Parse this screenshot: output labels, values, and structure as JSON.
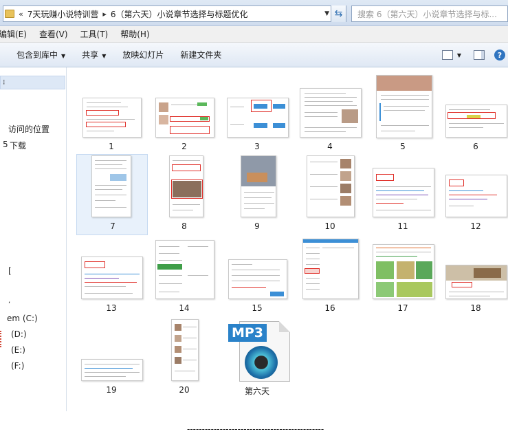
{
  "address_bar": {
    "lead_symbol": "«",
    "crumbs": [
      "7天玩赚小说特训营",
      "6（第六天）小说章节选择与标题优化"
    ],
    "search_placeholder": "搜索 6（第六天）小说章节选择与标..."
  },
  "menu": [
    "编辑(E)",
    "查看(V)",
    "工具(T)",
    "帮助(H)"
  ],
  "toolbar": {
    "include_library": "包含到库中",
    "share": "共享",
    "slideshow": "放映幻灯片",
    "new_folder": "新建文件夹"
  },
  "nav": {
    "recent_places": "访问的位置",
    "downloads": "下载",
    "bracket": "[",
    "drive_c": "em (C:)",
    "drive_d": "(D:)",
    "drive_e": "(E:)",
    "drive_f": "(F:)",
    "downloads_prefix": "5"
  },
  "files": [
    {
      "label": "1"
    },
    {
      "label": "2"
    },
    {
      "label": "3"
    },
    {
      "label": "4"
    },
    {
      "label": "5"
    },
    {
      "label": "6"
    },
    {
      "label": "7"
    },
    {
      "label": "8"
    },
    {
      "label": "9"
    },
    {
      "label": "10"
    },
    {
      "label": "11"
    },
    {
      "label": "12"
    },
    {
      "label": "13"
    },
    {
      "label": "14"
    },
    {
      "label": "15"
    },
    {
      "label": "16"
    },
    {
      "label": "17"
    },
    {
      "label": "18"
    },
    {
      "label": "19"
    },
    {
      "label": "20"
    },
    {
      "label": "第六天",
      "type": "mp3",
      "badge": "MP3"
    }
  ],
  "selected_file": "7",
  "status_line": "----------------------------------------------",
  "icons": {
    "folder": "folder-icon",
    "refresh": "refresh-icon",
    "views": "views-icon",
    "preview_pane": "preview-pane-icon",
    "help": "help-icon"
  }
}
